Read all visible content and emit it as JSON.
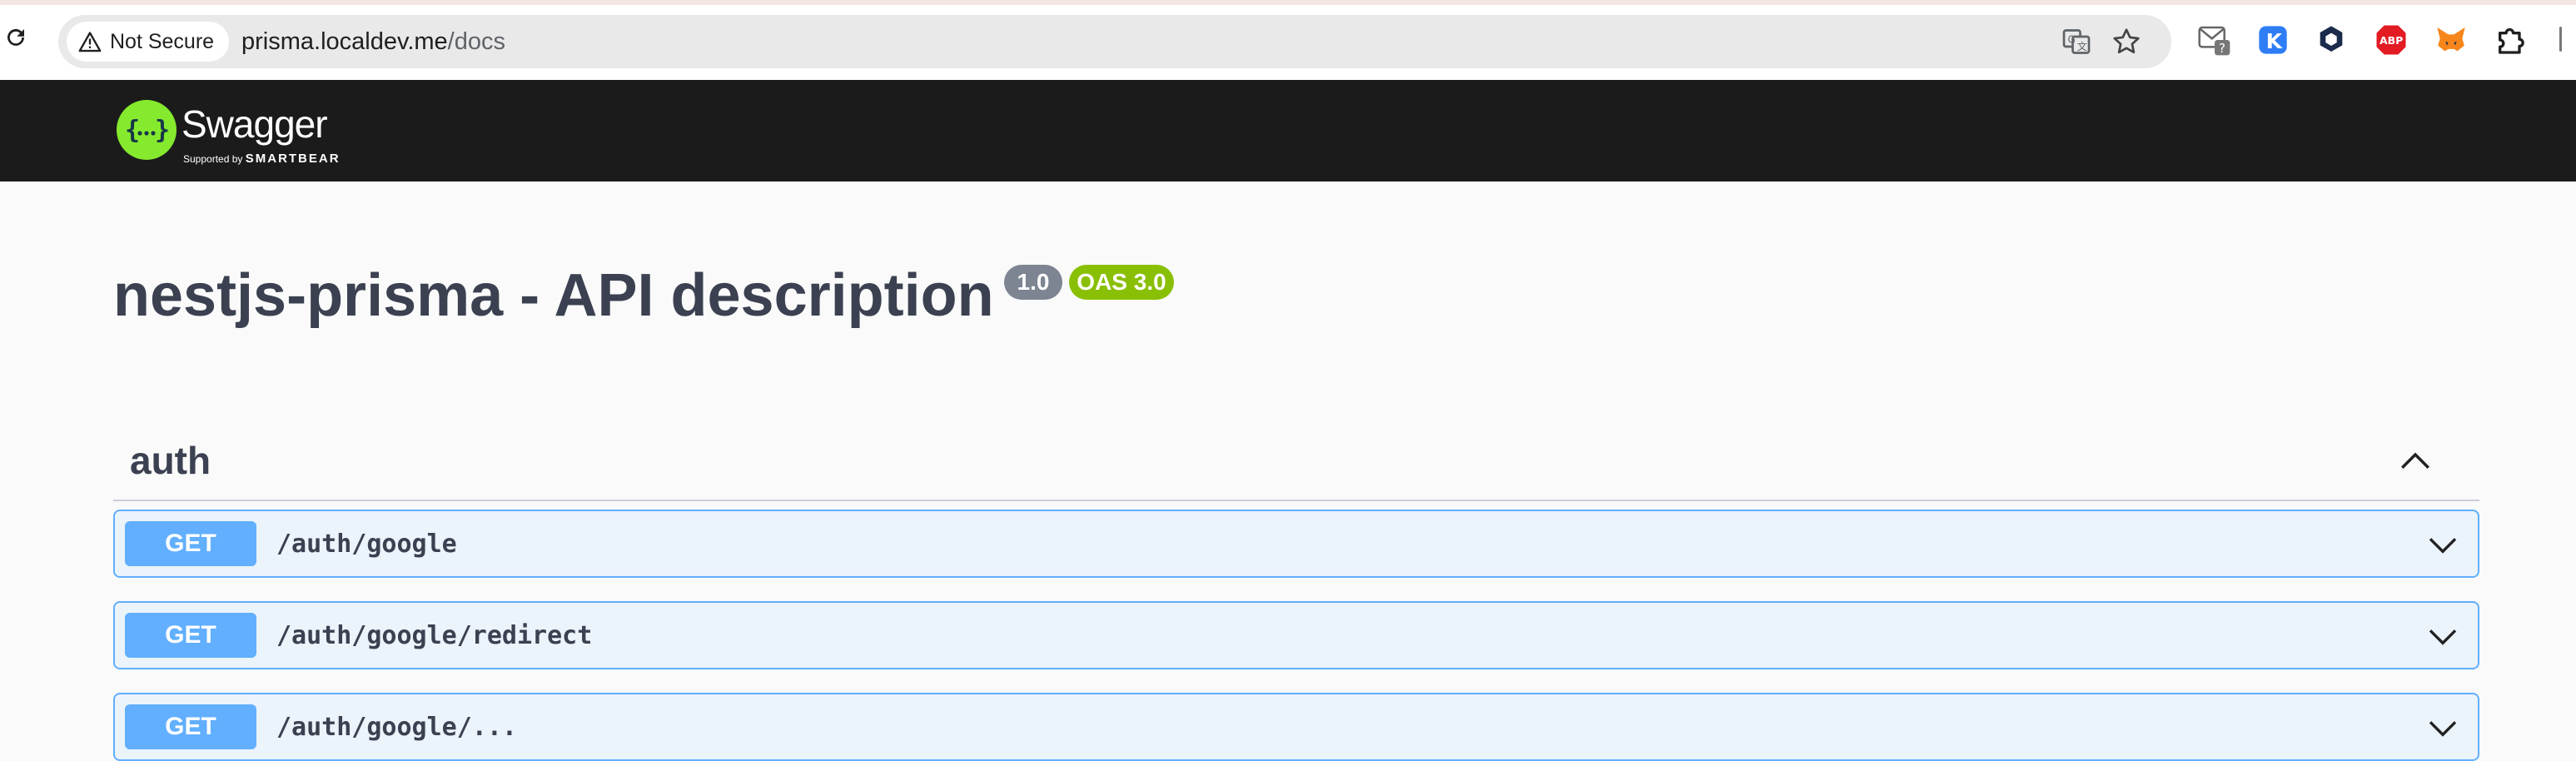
{
  "browser": {
    "security_label": "Not Secure",
    "url_host": "prisma.localdev.me",
    "url_path": "/docs",
    "extensions": [
      "gmail-checker-icon",
      "k-extension-icon",
      "cube-extension-icon",
      "adblock-plus-icon",
      "metamask-icon",
      "extensions-puzzle-icon"
    ]
  },
  "swagger": {
    "logo_text": "Swagger",
    "logo_supported_by": "Supported by",
    "logo_brand": "SMARTBEAR"
  },
  "info": {
    "title": "nestjs-prisma - API description",
    "version": "1.0",
    "oas": "OAS 3.0"
  },
  "tag": {
    "name": "auth"
  },
  "operations": [
    {
      "method": "GET",
      "path": "/auth/google"
    },
    {
      "method": "GET",
      "path": "/auth/google/redirect"
    },
    {
      "method": "GET",
      "path": "/auth/google/..."
    }
  ],
  "colors": {
    "get_method": "#61affe",
    "get_background": "#ebf3fb",
    "topbar": "#1b1b1b",
    "swagger_green": "#85ea2d",
    "oas_badge": "#89bf04",
    "version_badge": "#7d8492"
  }
}
